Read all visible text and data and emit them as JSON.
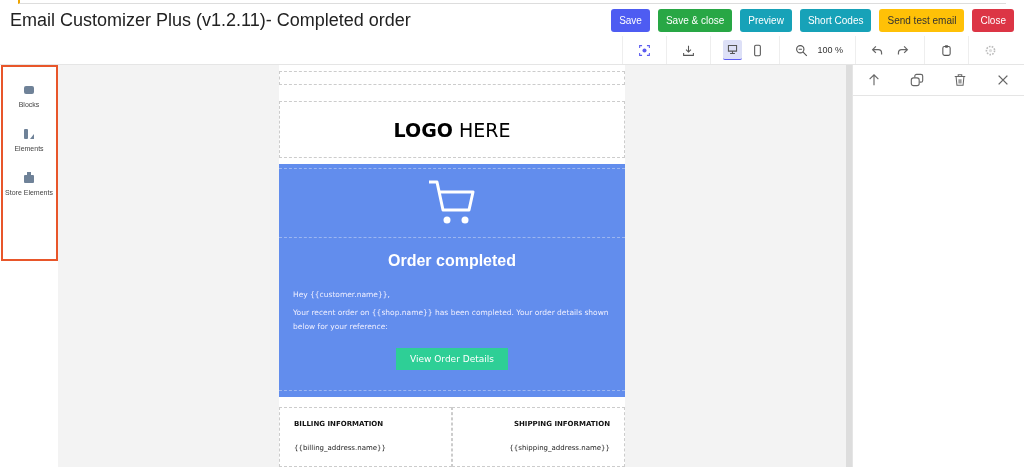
{
  "title": "Email Customizer Plus (v1.2.11)- Completed order",
  "actions": [
    {
      "label": "Save",
      "color": "#4e5cf2"
    },
    {
      "label": "Save & close",
      "color": "#28a745"
    },
    {
      "label": "Preview",
      "color": "#17a2b8"
    },
    {
      "label": "Short Codes",
      "color": "#17a2b8"
    },
    {
      "label": "Send test email",
      "color": "#ffc107"
    },
    {
      "label": "Close",
      "color": "#dc3545"
    }
  ],
  "toolbar": [
    {
      "kind": "focus",
      "selected": false
    },
    {
      "kind": "download",
      "selected": false
    },
    {
      "kind": "desktop",
      "selected": true
    },
    {
      "kind": "mobile",
      "selected": false
    },
    {
      "kind": "zoom",
      "label": "100 %",
      "selected": false
    },
    {
      "kind": "undo",
      "selected": false
    },
    {
      "kind": "redo",
      "selected": false
    },
    {
      "kind": "clipboard",
      "selected": false
    },
    {
      "kind": "settings",
      "selected": false
    }
  ],
  "sidebar": {
    "highlighted": true,
    "items": [
      {
        "kind": "blocks",
        "label": "Blocks"
      },
      {
        "kind": "elements",
        "label": "Elements"
      },
      {
        "kind": "store",
        "label": "Store Elements"
      }
    ]
  },
  "email": {
    "logo": "**LOGO** HERE",
    "heading": "Order completed",
    "greeting": "Hey {{customer.name}},",
    "body": "Your recent order on {{shop.name}}  has been completed. Your order details shown below for your reference:",
    "button": "View Order Details",
    "billing": {
      "title": "BILLING INFORMATION",
      "name": "{{billing_address.name}}"
    },
    "shipping": {
      "title": "SHIPPING INFORMATION",
      "name": "{{shipping_address.name}}"
    }
  }
}
